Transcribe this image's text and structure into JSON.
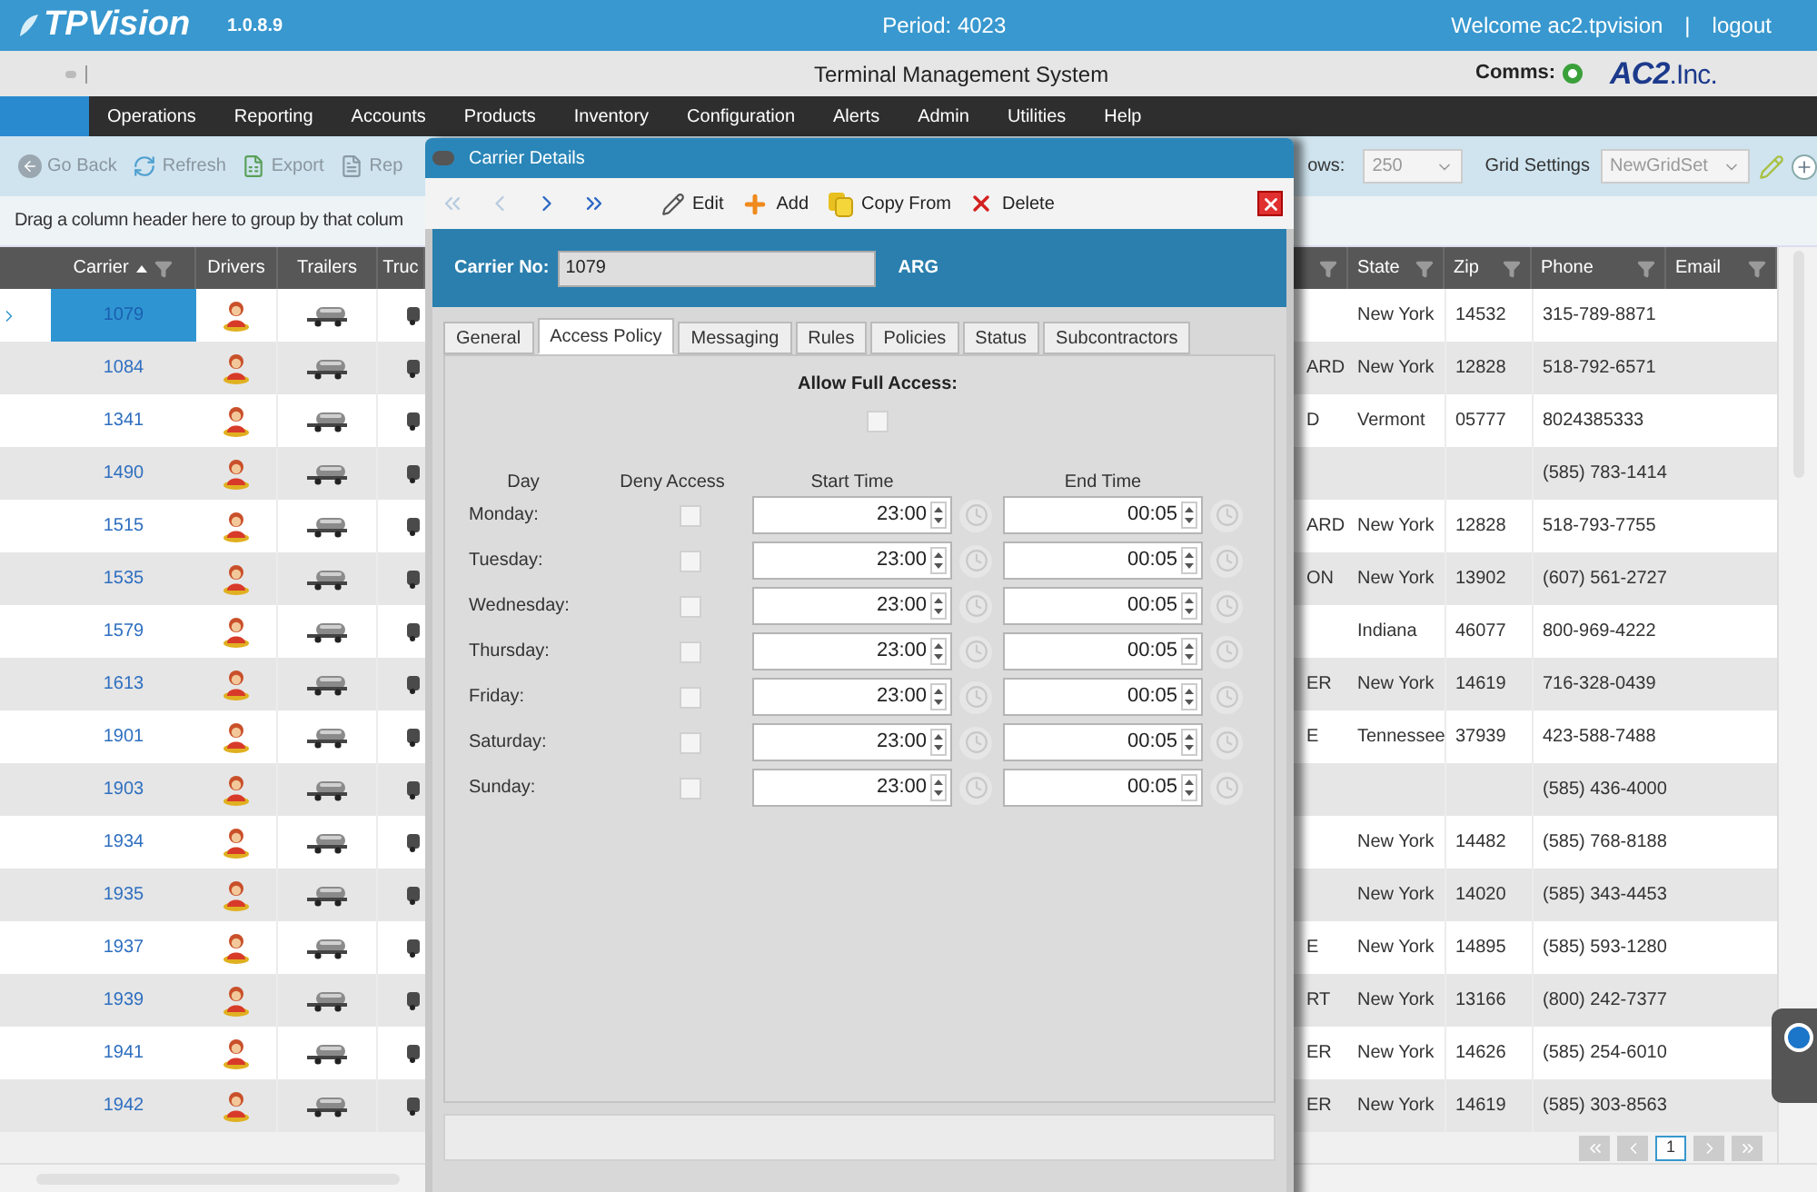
{
  "header": {
    "logo": "TPVision",
    "version": "1.0.8.9",
    "period": "Period: 4023",
    "welcome": "Welcome ac2.tpvision",
    "separator": "|",
    "logout": "logout"
  },
  "subheader": {
    "title": "Terminal Management System",
    "comms_label": "Comms:",
    "comms_online": true,
    "brand_main": "AC2",
    "brand_suffix": ".Inc."
  },
  "menu": {
    "home_selected": true,
    "items": [
      {
        "label": "Operations",
        "selected": false
      },
      {
        "label": "Reporting",
        "selected": false
      },
      {
        "label": "Accounts",
        "selected": false
      },
      {
        "label": "Products",
        "selected": false
      },
      {
        "label": "Inventory",
        "selected": false
      },
      {
        "label": "Configuration",
        "selected": false
      },
      {
        "label": "Alerts",
        "selected": false
      },
      {
        "label": "Admin",
        "selected": false
      },
      {
        "label": "Utilities",
        "selected": false
      },
      {
        "label": "Help",
        "selected": false
      }
    ]
  },
  "toolbar": {
    "buttons": [
      {
        "kind": "back",
        "label": "Go Back"
      },
      {
        "kind": "refresh",
        "label": "Refresh"
      },
      {
        "kind": "export",
        "label": "Export"
      },
      {
        "kind": "report",
        "label": "Rep"
      }
    ],
    "rows_label": "ows:",
    "rows_value": "250",
    "grid_settings_label": "Grid Settings",
    "grid_set": "NewGridSet"
  },
  "group_hint": "Drag a column header here to group by that colum",
  "grid": {
    "columns_left": [
      {
        "label": "Carrier",
        "sorted_ascending": true,
        "filter": true
      },
      {
        "label": "Drivers",
        "filter": false
      },
      {
        "label": "Trailers",
        "filter": false
      },
      {
        "label": "Truc",
        "filter": false
      }
    ],
    "columns_right": [
      {
        "filter": true
      },
      {
        "label": "State",
        "filter": true
      },
      {
        "label": "Zip",
        "filter": true
      },
      {
        "label": "Phone",
        "filter": true
      },
      {
        "label": "Email",
        "filter": true
      }
    ],
    "rows": [
      {
        "carrier": "1079",
        "selected": true,
        "state": "New York",
        "zip": "14532",
        "phone": "315-789-8871"
      },
      {
        "carrier": "1084",
        "selected": false,
        "column_5": "ARD",
        "state": "New York",
        "zip": "12828",
        "phone": "518-792-6571"
      },
      {
        "carrier": "1341",
        "selected": false,
        "column_5": "D",
        "state": "Vermont",
        "zip": "05777",
        "phone": "8024385333"
      },
      {
        "carrier": "1490",
        "selected": false,
        "phone": "(585) 783-1414"
      },
      {
        "carrier": "1515",
        "selected": false,
        "column_5": "ARD",
        "state": "New York",
        "zip": "12828",
        "phone": "518-793-7755"
      },
      {
        "carrier": "1535",
        "selected": false,
        "column_5": "ON",
        "state": "New York",
        "zip": "13902",
        "phone": "(607) 561-2727"
      },
      {
        "carrier": "1579",
        "selected": false,
        "state": "Indiana",
        "zip": "46077",
        "phone": "800-969-4222"
      },
      {
        "carrier": "1613",
        "selected": false,
        "column_5": "ER",
        "state": "New York",
        "zip": "14619",
        "phone": "716-328-0439"
      },
      {
        "carrier": "1901",
        "selected": false,
        "column_5": "E",
        "state": "Tennessee",
        "zip": "37939",
        "phone": "423-588-7488"
      },
      {
        "carrier": "1903",
        "selected": false,
        "phone": "(585) 436-4000"
      },
      {
        "carrier": "1934",
        "selected": false,
        "state": "New York",
        "zip": "14482",
        "phone": "(585) 768-8188"
      },
      {
        "carrier": "1935",
        "selected": false,
        "state": "New York",
        "zip": "14020",
        "phone": "(585) 343-4453"
      },
      {
        "carrier": "1937",
        "selected": false,
        "column_5": "E",
        "state": "New York",
        "zip": "14895",
        "phone": "(585) 593-1280"
      },
      {
        "carrier": "1939",
        "selected": false,
        "column_5": "RT",
        "state": "New York",
        "zip": "13166",
        "phone": "(800) 242-7377"
      },
      {
        "carrier": "1941",
        "selected": false,
        "column_5": "ER",
        "state": "New York",
        "zip": "14626",
        "phone": "(585) 254-6010"
      },
      {
        "carrier": "1942",
        "selected": false,
        "column_5": "ER",
        "state": "New York",
        "zip": "14619",
        "phone": "(585) 303-8563"
      }
    ],
    "pager": {
      "pages": [
        {
          "label": "1",
          "selected": true
        }
      ]
    }
  },
  "dialog": {
    "title": "Carrier Details",
    "nav": [
      {
        "kind": "first",
        "disabled": true
      },
      {
        "kind": "prev",
        "disabled": true
      },
      {
        "kind": "next",
        "disabled": false
      },
      {
        "kind": "last",
        "disabled": false
      }
    ],
    "actions": [
      {
        "kind": "edit",
        "label": "Edit"
      },
      {
        "kind": "add",
        "label": "Add"
      },
      {
        "kind": "copy",
        "label": "Copy From"
      },
      {
        "kind": "delete",
        "label": "Delete"
      }
    ],
    "carrier_no_label": "Carrier No:",
    "carrier_no": "1079",
    "carrier_code": "ARG",
    "tabs": [
      {
        "label": "General",
        "selected": false
      },
      {
        "label": "Access Policy",
        "selected": true
      },
      {
        "label": "Messaging",
        "selected": false
      },
      {
        "label": "Rules",
        "selected": false
      },
      {
        "label": "Policies",
        "selected": false
      },
      {
        "label": "Status",
        "selected": false
      },
      {
        "label": "Subcontractors",
        "selected": false
      }
    ],
    "allow_full_access": {
      "label": "Allow Full Access:",
      "checked": false
    },
    "schedule": {
      "columns": [
        "Day",
        "Deny Access",
        "Start Time",
        "End Time"
      ],
      "rows": [
        {
          "day": "Monday:",
          "deny": false,
          "start": "23:00",
          "end": "00:05"
        },
        {
          "day": "Tuesday:",
          "deny": false,
          "start": "23:00",
          "end": "00:05"
        },
        {
          "day": "Wednesday:",
          "deny": false,
          "start": "23:00",
          "end": "00:05"
        },
        {
          "day": "Thursday:",
          "deny": false,
          "start": "23:00",
          "end": "00:05"
        },
        {
          "day": "Friday:",
          "deny": false,
          "start": "23:00",
          "end": "00:05"
        },
        {
          "day": "Saturday:",
          "deny": false,
          "start": "23:00",
          "end": "00:05"
        },
        {
          "day": "Sunday:",
          "deny": false,
          "start": "23:00",
          "end": "00:05"
        }
      ]
    }
  }
}
